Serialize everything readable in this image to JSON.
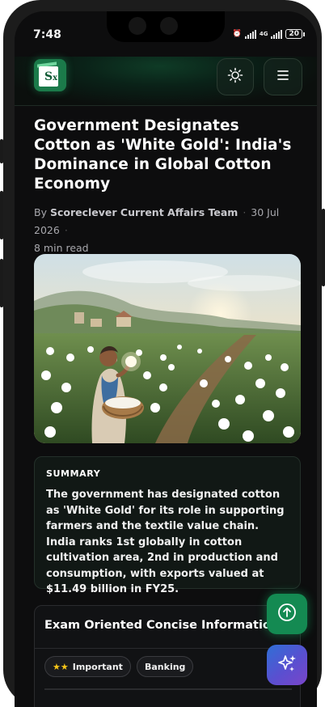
{
  "status_bar": {
    "time": "7:48",
    "network": "4G",
    "battery": "20"
  },
  "header": {
    "logo_text": "S",
    "logo_sub": "x",
    "theme_icon": "sun-icon",
    "menu_icon": "hamburger-icon"
  },
  "article": {
    "title": "Government Designates Cotton as 'White Gold': India's Dominance in Global Cotton Economy",
    "by_label": "By",
    "author": "Scoreclever Current Affairs Team",
    "date": "30 Jul 2026",
    "read_time": "8 min read"
  },
  "summary": {
    "label": "SUMMARY",
    "text": "The government has designated cotton as 'White Gold' for its role in supporting farmers and the textile value chain. India ranks 1st globally in cotton cultivation area, 2nd in production and consumption, with exports valued at $11.49 billion in FY25."
  },
  "exam_section": {
    "title": "Exam Oriented Concise Information",
    "tags": [
      {
        "label": "Important",
        "stars": "★★"
      },
      {
        "label": "Banking"
      }
    ]
  },
  "fabs": {
    "scroll_top_icon": "arrow-up-icon",
    "ai_icon": "sparkles-icon"
  },
  "colors": {
    "background": "#0d0d0e",
    "accent": "#148a52",
    "star": "#f5c518"
  }
}
